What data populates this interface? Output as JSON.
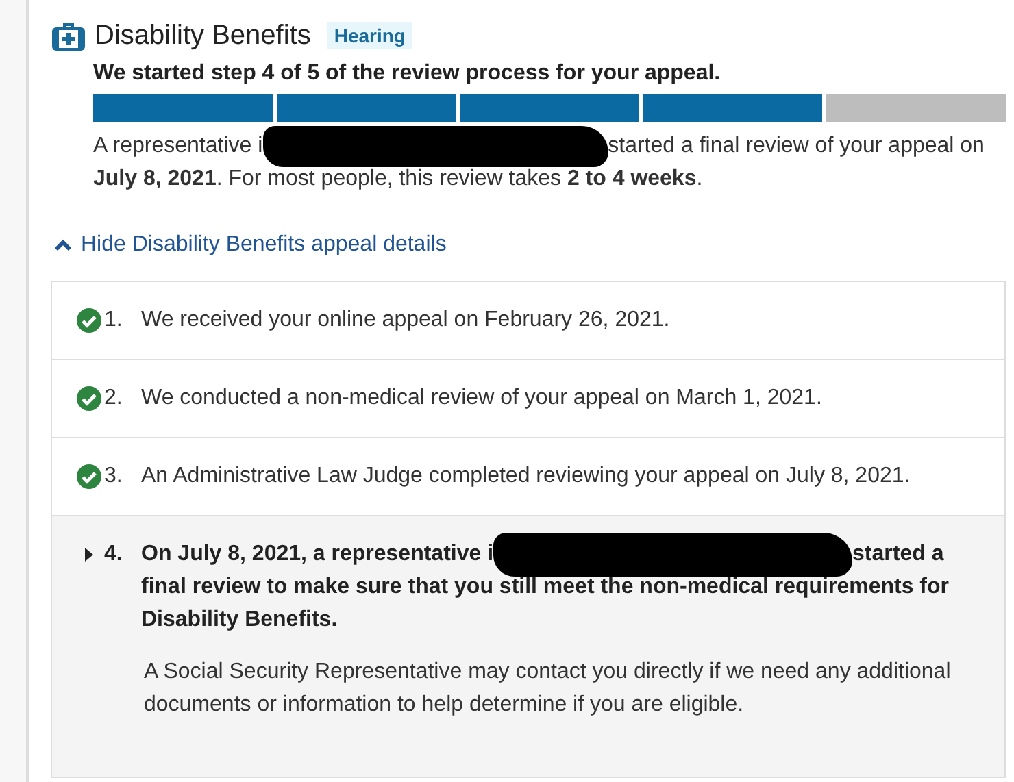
{
  "header": {
    "title": "Disability Benefits",
    "badge": "Hearing"
  },
  "status": "We started step 4 of 5 of the review process for your appeal.",
  "progress": [
    {
      "complete": true
    },
    {
      "complete": true
    },
    {
      "complete": true
    },
    {
      "complete": true
    },
    {
      "complete": false
    }
  ],
  "intro": {
    "before": "A representative i",
    "after": "started a final review of your appeal on",
    "rest": "**July 8, 2021**. For most people, this review takes **2 to 4 weeks**."
  },
  "toggle": {
    "label": "Hide Disability Benefits appeal details",
    "expanded": true
  },
  "steps": [
    {
      "kind": "done",
      "number": "1.",
      "text": "We received your online appeal on February 26, 2021."
    },
    {
      "kind": "done",
      "number": "2.",
      "text": "We conducted a non-medical review of your appeal on March 1, 2021."
    },
    {
      "kind": "done",
      "number": "3.",
      "text": "An Administrative Law Judge completed reviewing your appeal on July 8, 2021."
    },
    {
      "kind": "current",
      "number": "4.",
      "before": "On July 8, 2021, a representative i",
      "after": "started a",
      "rest": "final review to make sure that you still meet the non-medical requirements for Disability Benefits.",
      "detail": "A Social Security Representative may contact you directly if we need any additional documents or information to help determine if you are eligible."
    }
  ]
}
